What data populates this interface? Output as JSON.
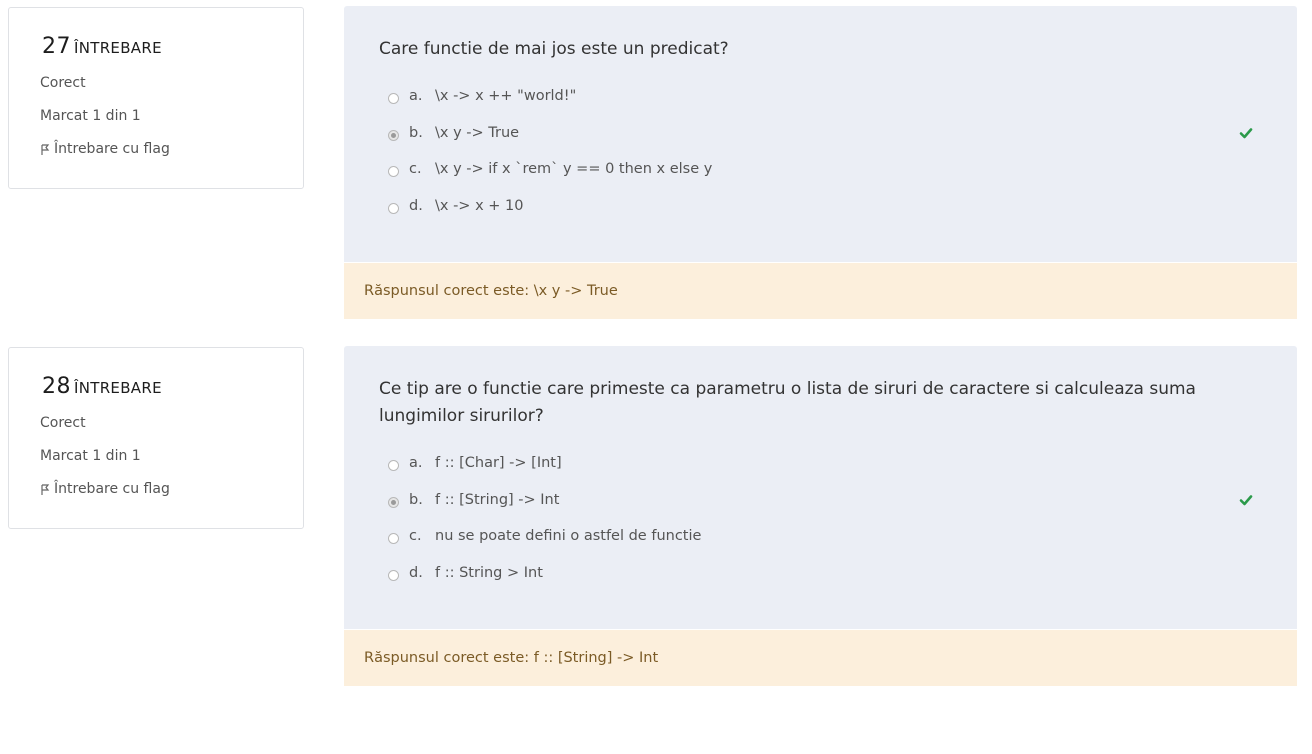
{
  "questions": [
    {
      "number": "27",
      "label": "ÎNTREBARE",
      "state": "Corect",
      "grade": "Marcat 1 din 1",
      "flag_label": "Întrebare cu flag",
      "text": "Care functie de mai jos este un predicat?",
      "answers": [
        {
          "letter": "a.",
          "text": "\\x -> x ++ \"world!\"",
          "selected": false
        },
        {
          "letter": "b.",
          "text": "\\x y -> True",
          "selected": true
        },
        {
          "letter": "c.",
          "text": "\\x y -> if x `rem` y == 0 then x else y",
          "selected": false
        },
        {
          "letter": "d.",
          "text": "\\x -> x + 10",
          "selected": false
        }
      ],
      "feedback": "Răspunsul corect este: \\x y -> True"
    },
    {
      "number": "28",
      "label": "ÎNTREBARE",
      "state": "Corect",
      "grade": "Marcat 1 din 1",
      "flag_label": "Întrebare cu flag",
      "text": "Ce tip are o functie care primeste ca parametru o lista de siruri de caractere si calculeaza suma lungimilor sirurilor?",
      "answers": [
        {
          "letter": "a.",
          "text": "f :: [Char] -> [Int]",
          "selected": false
        },
        {
          "letter": "b.",
          "text": "f :: [String] -> Int",
          "selected": true
        },
        {
          "letter": "c.",
          "text": "nu se poate defini o astfel de functie",
          "selected": false
        },
        {
          "letter": "d.",
          "text": "f :: String > Int",
          "selected": false
        }
      ],
      "feedback": "Răspunsul corect este: f :: [String] -> Int"
    }
  ],
  "icons": {
    "flag": "flag-icon",
    "correct": "check-icon"
  },
  "colors": {
    "content_bg": "#ebeef5",
    "feedback_bg": "#fcefdc",
    "correct": "#2b9a4a"
  }
}
